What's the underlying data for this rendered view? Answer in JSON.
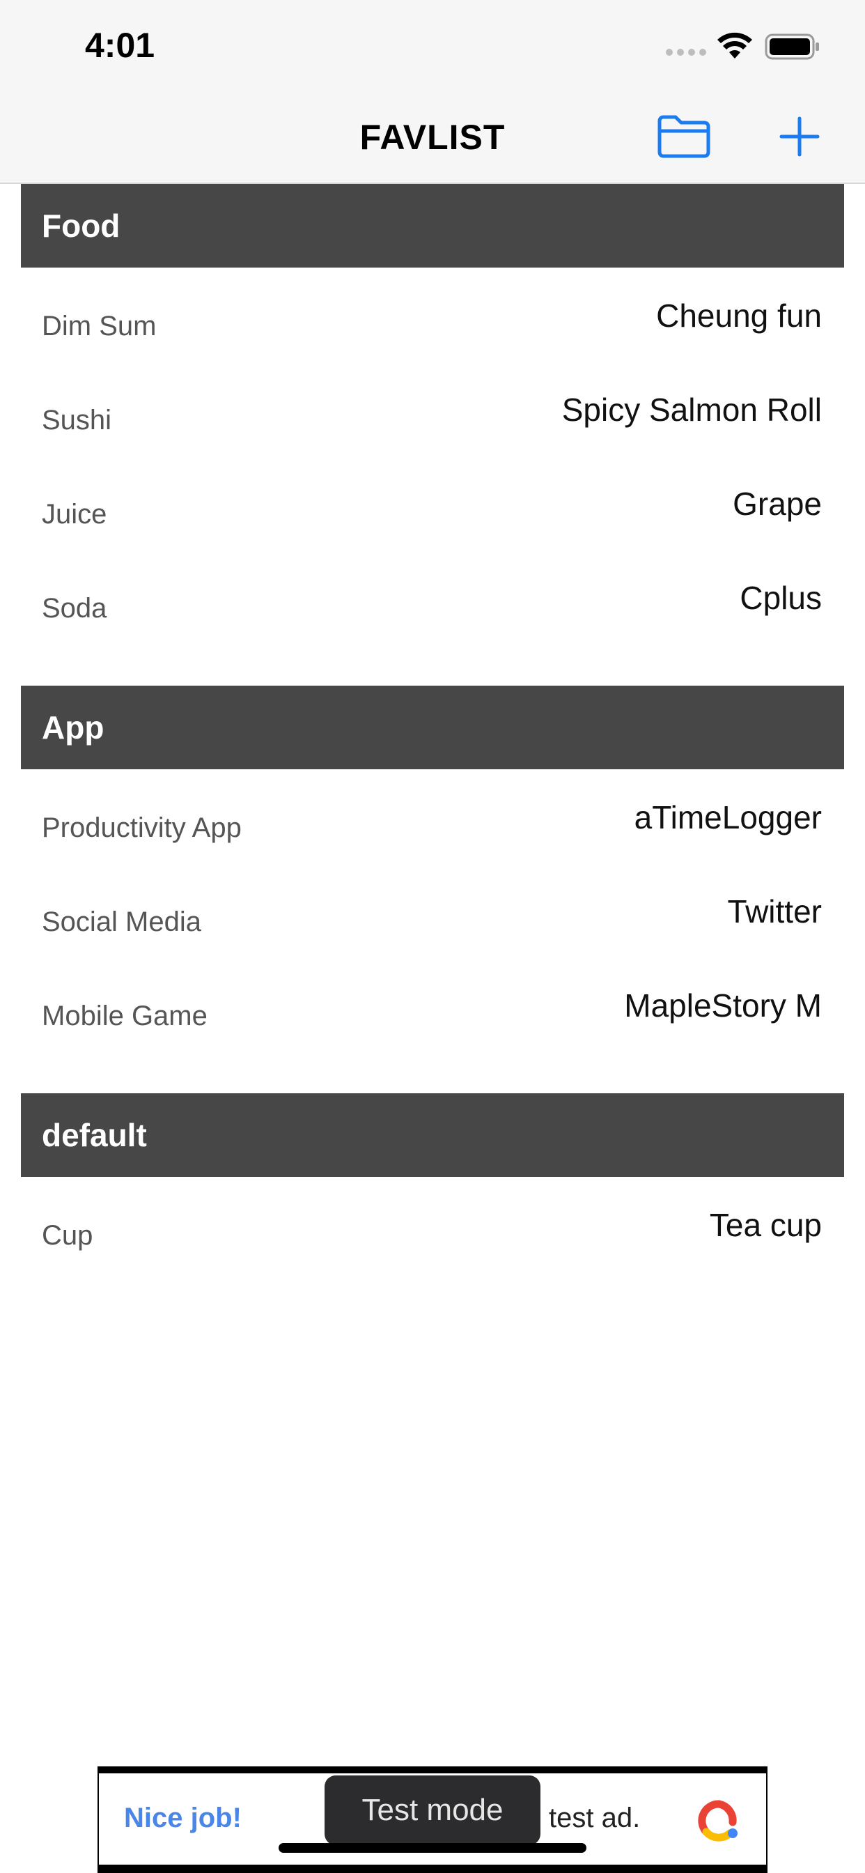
{
  "status_bar": {
    "time": "4:01"
  },
  "nav": {
    "title": "FAVLIST"
  },
  "sections": [
    {
      "title": "Food",
      "rows": [
        {
          "label": "Dim Sum",
          "value": "Cheung fun"
        },
        {
          "label": "Sushi",
          "value": "Spicy Salmon Roll"
        },
        {
          "label": "Juice",
          "value": "Grape"
        },
        {
          "label": "Soda",
          "value": "Cplus"
        }
      ]
    },
    {
      "title": "App",
      "rows": [
        {
          "label": "Productivity App",
          "value": "aTimeLogger"
        },
        {
          "label": "Social Media",
          "value": "Twitter"
        },
        {
          "label": "Mobile Game",
          "value": "MapleStory M"
        }
      ]
    },
    {
      "title": "default",
      "rows": [
        {
          "label": "Cup",
          "value": "Tea cup"
        }
      ]
    }
  ],
  "ad": {
    "nice_label": "Nice job!",
    "text": "test ad.",
    "test_mode_label": "Test mode"
  },
  "icons": {
    "folder": "folder-icon",
    "add": "plus-icon",
    "wifi": "wifi-icon",
    "battery": "battery-icon"
  },
  "colors": {
    "accent": "#1a7cf0",
    "section_header_bg": "#474747"
  }
}
